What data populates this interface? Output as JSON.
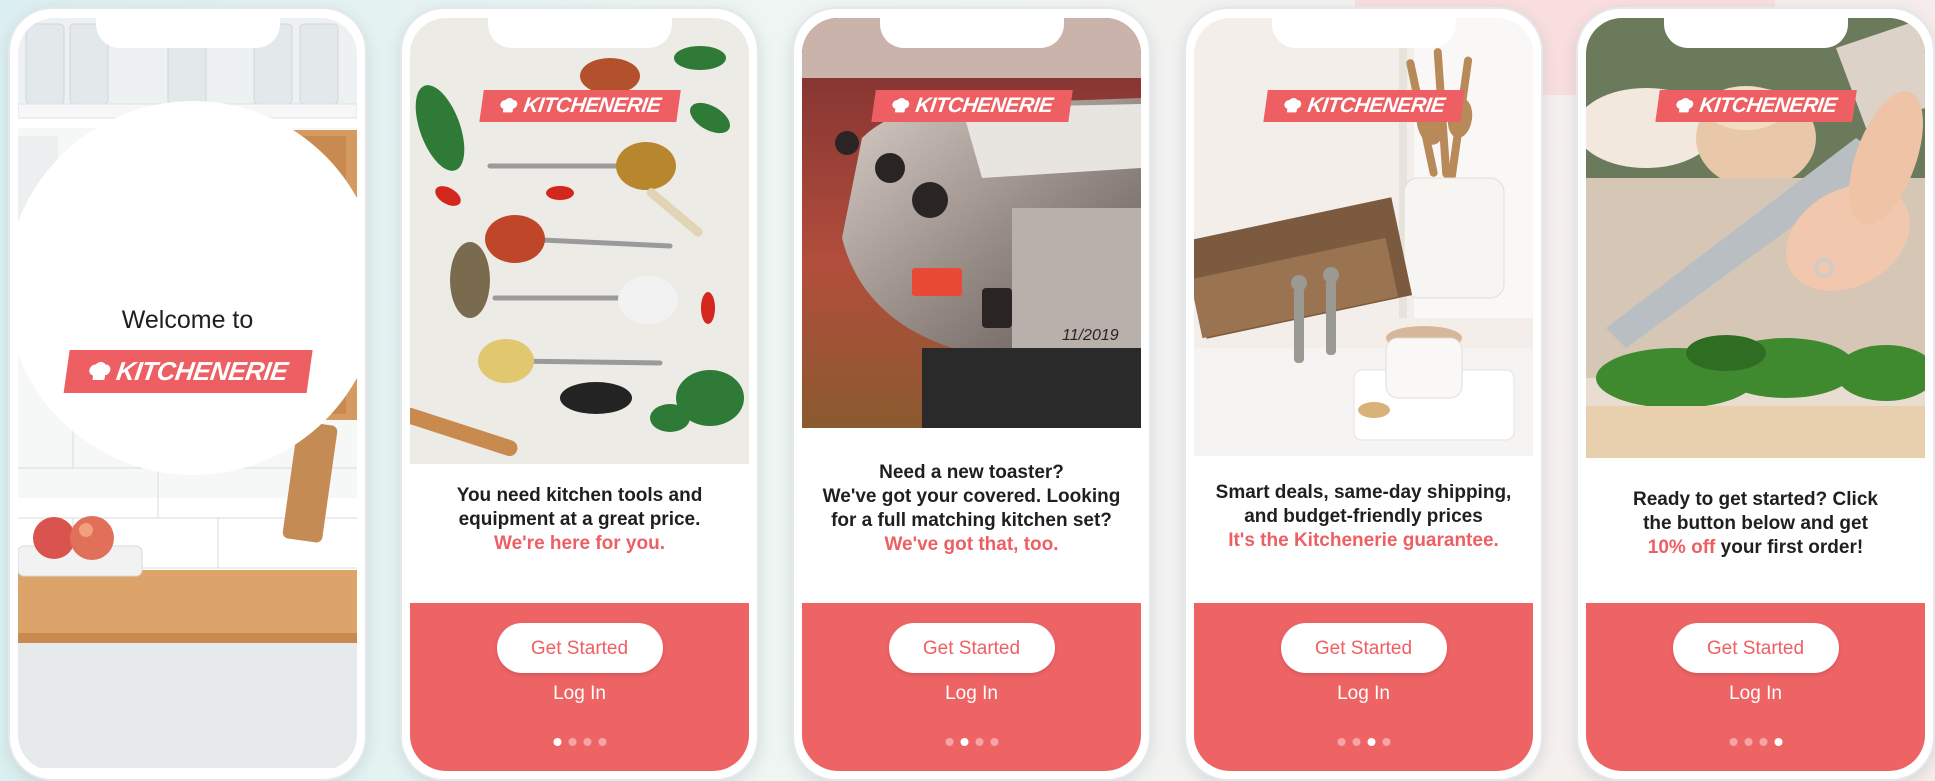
{
  "brand": {
    "name": "KITCHENERIE",
    "icon": "chef-hat-icon",
    "colors": {
      "accent": "#ee5f63",
      "button_text": "#ee5f63",
      "body_text": "#1f1f1f"
    }
  },
  "welcome_screen": {
    "heading": "Welcome to"
  },
  "onboarding_screens": [
    {
      "lines": [
        "You need kitchen tools and",
        "equipment at a great price."
      ],
      "highlight": "We're here for you.",
      "get_started": "Get Started",
      "login": "Log In",
      "active_page": 1,
      "photo_icon": "spices-photo"
    },
    {
      "lines": [
        "Need a new toaster?",
        "We've got your covered. Looking",
        "for a full matching kitchen set?"
      ],
      "highlight": "We've got that, too.",
      "get_started": "Get Started",
      "login": "Log In",
      "active_page": 2,
      "photo_icon": "toaster-photo"
    },
    {
      "lines": [
        "Smart deals, same-day shipping,",
        "and budget-friendly prices"
      ],
      "highlight": "It's the Kitchenerie guarantee.",
      "get_started": "Get Started",
      "login": "Log In",
      "active_page": 3,
      "photo_icon": "utensils-photo"
    },
    {
      "lines": [
        "Ready to get started? Click",
        "the button below and get"
      ],
      "highlight": "10% off",
      "line_end": " your first order!",
      "get_started": "Get Started",
      "login": "Log In",
      "active_page": 4,
      "photo_icon": "chopping-herbs-photo"
    }
  ],
  "page_count": 4
}
